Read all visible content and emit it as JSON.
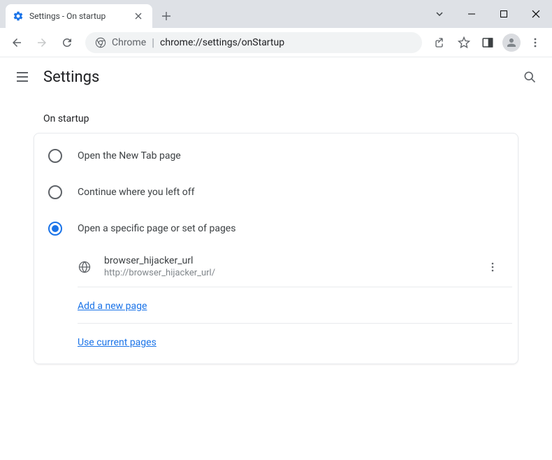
{
  "tab": {
    "title": "Settings - On startup"
  },
  "omnibox": {
    "prefix": "Chrome",
    "url": "chrome://settings/onStartup"
  },
  "header": {
    "title": "Settings"
  },
  "section": {
    "title": "On startup",
    "options": [
      {
        "label": "Open the New Tab page"
      },
      {
        "label": "Continue where you left off"
      },
      {
        "label": "Open a specific page or set of pages"
      }
    ],
    "pages": [
      {
        "title": "browser_hijacker_url",
        "url": "http://browser_hijacker_url/"
      }
    ],
    "links": {
      "add": "Add a new page",
      "current": "Use current pages"
    }
  }
}
